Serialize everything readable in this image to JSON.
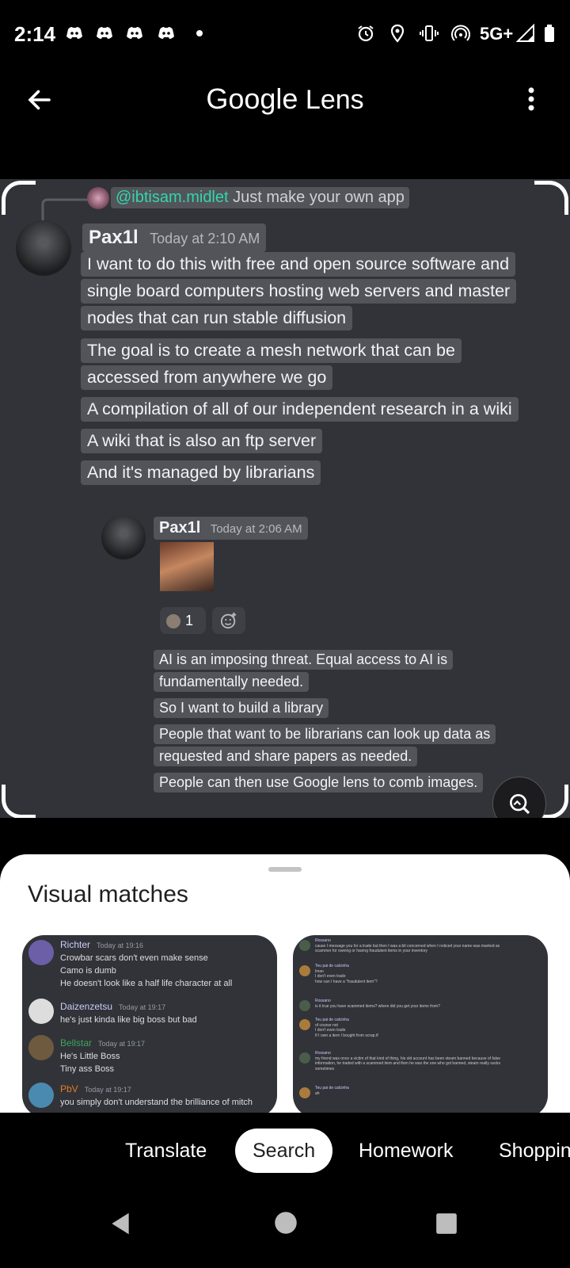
{
  "status_bar": {
    "time": "2:14",
    "network": "5G+",
    "icons": [
      "discord-icon",
      "discord-icon",
      "discord-icon",
      "discord-icon",
      "dot-icon",
      "alarm-icon",
      "location-icon",
      "vibrate-icon",
      "hotspot-icon",
      "signal-icon",
      "battery-icon"
    ]
  },
  "app_bar": {
    "title_google": "Google",
    "title_lens": "Lens"
  },
  "image": {
    "reply_mention": "@ibtisam.midlet",
    "reply_text": "Just make your own app",
    "msg1": {
      "author": "Pax1l",
      "time": "Today at 2:10 AM",
      "lines": [
        "I want to do this with free and open source software and",
        "single board computers hosting web servers and master",
        "nodes that can run stable diffusion",
        "The goal is to create a mesh network that can be",
        "accessed from anywhere we go",
        "A compilation of all of our independent research in a wiki",
        "A wiki that is also an ftp server",
        "And it's managed by librarians"
      ]
    },
    "msg2": {
      "author": "Pax1l",
      "time": "Today at 2:06 AM",
      "reaction_count": "1",
      "lines": [
        "AI is an imposing threat. Equal access to AI is",
        "fundamentally needed.",
        "So I want to build a library",
        "People that want to be librarians can look up data as",
        "requested and share papers as needed.",
        "People can then use Google lens to comb images."
      ]
    }
  },
  "sheet": {
    "title": "Visual matches",
    "card1": {
      "messages": [
        {
          "name": "Richter",
          "time": "Today at 19:16",
          "lines": [
            "Crowbar scars don't even make sense",
            "Camo is dumb",
            "He doesn't look like a half life character at all"
          ]
        },
        {
          "name": "Daizenzetsu",
          "time": "Today at 19:17",
          "lines": [
            "he's just kinda like big boss but bad"
          ]
        },
        {
          "name": "Bellstar",
          "time": "Today at 19:17",
          "lines": [
            "He's Little Boss",
            "Tiny ass Boss"
          ]
        },
        {
          "name": "PbV",
          "time": "Today at 19:17",
          "lines": [
            "you simply don't understand the brilliance of mitch"
          ]
        }
      ]
    },
    "card2": {
      "messages": [
        {
          "name": "Rossano",
          "lines": [
            "cause I message you for a trade but then I was a bit concerned when I noticed your name was marked as",
            "scammer for owning or having fraudulent items in your inventory"
          ]
        },
        {
          "name": "Teu pai de calcinha",
          "lines": [
            "lmao",
            "I don't even trade",
            "how can I have a \"fraudulent item\"?"
          ]
        },
        {
          "name": "Rossano",
          "lines": [
            "is it true you have scammed items? where did you get your items from?"
          ]
        },
        {
          "name": "Teu pai de calcinha",
          "lines": [
            "of course not",
            "I don't even trade",
            "If I own a item I bought from scrap.tf"
          ]
        },
        {
          "name": "Rossano",
          "lines": [
            "my friend was once a victim of that kind of thing, his old account has been steam banned because of false",
            "information, he traded with a scammed item and then he was the one who got banned, steam really sucks",
            "sometimes"
          ]
        },
        {
          "name": "Teu pai de calcinha",
          "lines": [
            "ah"
          ]
        }
      ]
    }
  },
  "tabs": [
    "Translate",
    "Search",
    "Homework",
    "Shoppin"
  ],
  "selected_tab": "Search"
}
